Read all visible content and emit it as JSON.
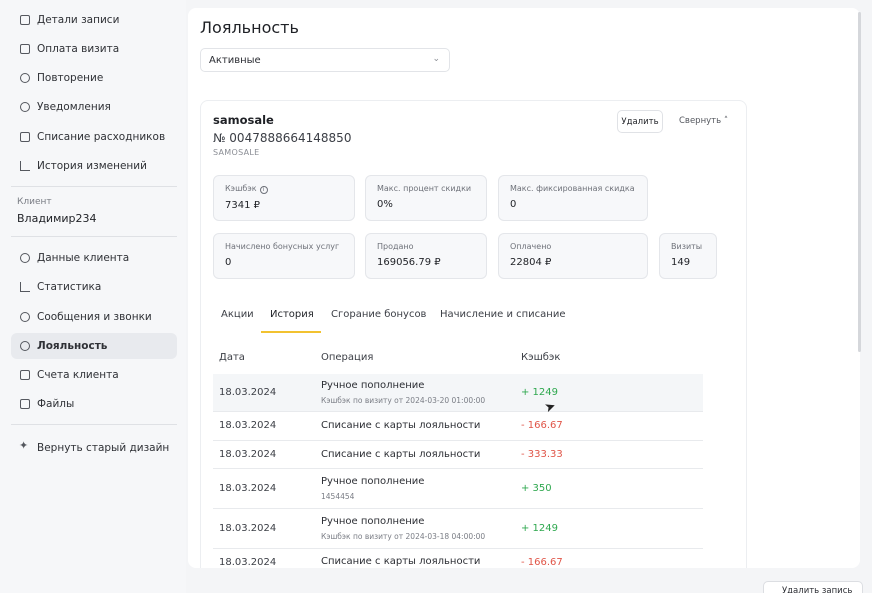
{
  "sidebar": {
    "top_items": [
      {
        "label": "Детали записи",
        "icon": "calendar-icon"
      },
      {
        "label": "Оплата визита",
        "icon": "card-icon"
      },
      {
        "label": "Повторение",
        "icon": "repeat-icon"
      },
      {
        "label": "Уведомления",
        "icon": "chat-icon"
      },
      {
        "label": "Списание расходников",
        "icon": "box-icon"
      },
      {
        "label": "История изменений",
        "icon": "list-icon"
      }
    ],
    "client_caption": "Клиент",
    "client_name": "Владимир234",
    "client_items": [
      {
        "label": "Данные клиента",
        "icon": "user-icon"
      },
      {
        "label": "Статистика",
        "icon": "chart-icon"
      },
      {
        "label": "Сообщения и звонки",
        "icon": "message-icon"
      },
      {
        "label": "Лояльность",
        "icon": "loyalty-icon",
        "active": true
      },
      {
        "label": "Счета клиента",
        "icon": "wallet-icon"
      },
      {
        "label": "Файлы",
        "icon": "folder-icon"
      }
    ],
    "old_design": "Вернуть старый дизайн"
  },
  "page": {
    "title": "Лояльность",
    "status_select": "Активные"
  },
  "card": {
    "name": "samosale",
    "number": "№ 0047888664148850",
    "subtitle": "SAMOSALE",
    "delete_label": "Удалить",
    "collapse_label": "Свернуть ˄",
    "stats": [
      {
        "label": "Кэшбэк",
        "value": "7341 ₽",
        "info": true
      },
      {
        "label": "Макс. процент скидки",
        "value": "0%"
      },
      {
        "label": "Макс. фиксированная скидка",
        "value": "0"
      },
      {
        "label": "Начислено бонусных услуг",
        "value": "0"
      },
      {
        "label": "Продано",
        "value": "169056.79 ₽"
      },
      {
        "label": "Оплачено",
        "value": "22804 ₽"
      },
      {
        "label": "Визиты",
        "value": "149"
      }
    ]
  },
  "tabs": [
    "Акции",
    "История",
    "Сгорание бонусов",
    "Начисление и списание"
  ],
  "active_tab": "История",
  "table": {
    "headers": [
      "Дата",
      "Операция",
      "Кэшбэк"
    ],
    "rows": [
      {
        "date": "18.03.2024",
        "op": "Ручное пополнение",
        "sub": "Кэшбэк по визиту от 2024-03-20 01:00:00",
        "cb": "+ 1249",
        "sign": "pos"
      },
      {
        "date": "18.03.2024",
        "op": "Списание с карты лояльности",
        "sub": "",
        "cb": "- 166.67",
        "sign": "neg"
      },
      {
        "date": "18.03.2024",
        "op": "Списание с карты лояльности",
        "sub": "",
        "cb": "- 333.33",
        "sign": "neg"
      },
      {
        "date": "18.03.2024",
        "op": "Ручное пополнение",
        "sub": "1454454",
        "cb": "+ 350",
        "sign": "pos"
      },
      {
        "date": "18.03.2024",
        "op": "Ручное пополнение",
        "sub": "Кэшбэк по визиту от 2024-03-18 04:00:00",
        "cb": "+ 1249",
        "sign": "pos"
      },
      {
        "date": "18.03.2024",
        "op": "Списание с карты лояльности",
        "sub": "",
        "cb": "- 166.67",
        "sign": "neg"
      }
    ]
  },
  "bottom_button": "Удалить запись",
  "colors": {
    "positive": "#2fa84f",
    "negative": "#e05548",
    "accent": "#f2c230"
  }
}
